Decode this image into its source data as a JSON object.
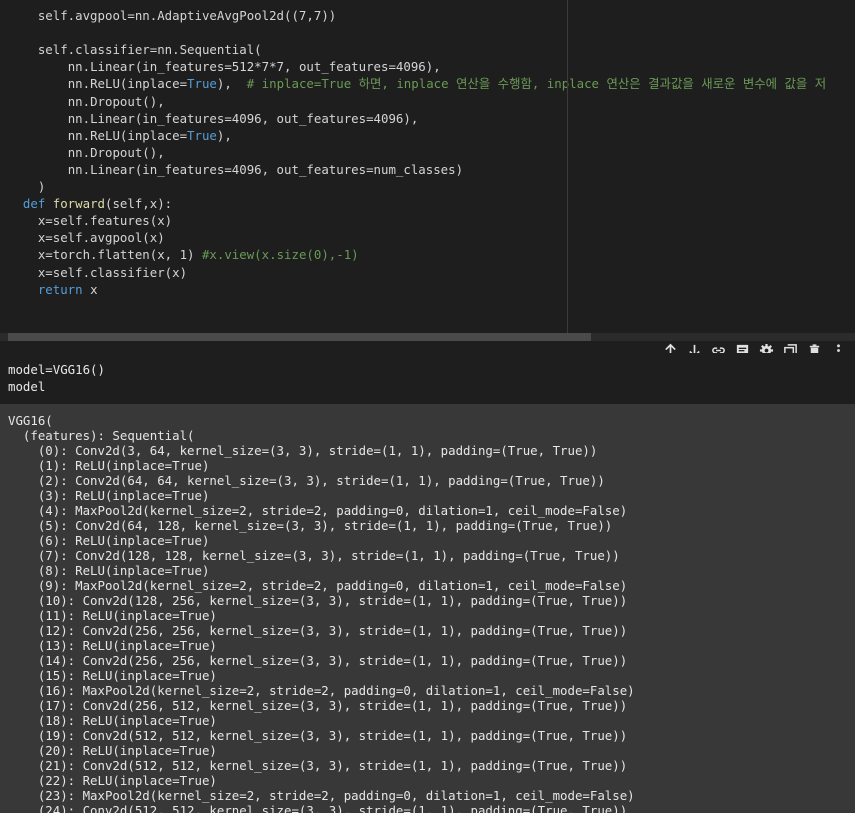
{
  "code_cell": {
    "lines": [
      {
        "indent": "    ",
        "parts": [
          {
            "t": "self.avgpool=nn.AdaptiveAvgPool2d((7,7))",
            "c": ""
          }
        ]
      },
      {
        "indent": "",
        "parts": []
      },
      {
        "indent": "    ",
        "parts": [
          {
            "t": "self.classifier=nn.Sequential(",
            "c": ""
          }
        ]
      },
      {
        "indent": "        ",
        "parts": [
          {
            "t": "nn.Linear(in_features=512*7*7, out_features=4096),",
            "c": ""
          }
        ]
      },
      {
        "indent": "        ",
        "parts": [
          {
            "t": "nn.ReLU(inplace=",
            "c": ""
          },
          {
            "t": "True",
            "c": "kw"
          },
          {
            "t": "),  ",
            "c": ""
          },
          {
            "t": "# inplace=True 하면, inplace 연산을 수행함, inplace 연산은 결과값을 새로운 변수에 값을 저",
            "c": "cm"
          }
        ]
      },
      {
        "indent": "        ",
        "parts": [
          {
            "t": "nn.Dropout(),",
            "c": ""
          }
        ]
      },
      {
        "indent": "        ",
        "parts": [
          {
            "t": "nn.Linear(in_features=4096, out_features=4096),",
            "c": ""
          }
        ]
      },
      {
        "indent": "        ",
        "parts": [
          {
            "t": "nn.ReLU(inplace=",
            "c": ""
          },
          {
            "t": "True",
            "c": "kw"
          },
          {
            "t": "),",
            "c": ""
          }
        ]
      },
      {
        "indent": "        ",
        "parts": [
          {
            "t": "nn.Dropout(),",
            "c": ""
          }
        ]
      },
      {
        "indent": "        ",
        "parts": [
          {
            "t": "nn.Linear(in_features=4096, out_features=num_classes)",
            "c": ""
          }
        ]
      },
      {
        "indent": "    ",
        "parts": [
          {
            "t": ")",
            "c": ""
          }
        ]
      },
      {
        "indent": "  ",
        "parts": [
          {
            "t": "def ",
            "c": "kw"
          },
          {
            "t": "forward",
            "c": "fn"
          },
          {
            "t": "(self,x):",
            "c": ""
          }
        ]
      },
      {
        "indent": "    ",
        "parts": [
          {
            "t": "x=self.features(x)",
            "c": ""
          }
        ]
      },
      {
        "indent": "    ",
        "parts": [
          {
            "t": "x=self.avgpool(x)",
            "c": ""
          }
        ]
      },
      {
        "indent": "    ",
        "parts": [
          {
            "t": "x=torch.flatten(x, 1) ",
            "c": ""
          },
          {
            "t": "#x.view(x.size(0),-1)",
            "c": "cm"
          }
        ]
      },
      {
        "indent": "    ",
        "parts": [
          {
            "t": "x=self.classifier(x)",
            "c": ""
          }
        ]
      },
      {
        "indent": "    ",
        "parts": [
          {
            "t": "return",
            "c": "kw"
          },
          {
            "t": " x",
            "c": ""
          }
        ]
      }
    ]
  },
  "toolbar": {
    "items": [
      {
        "name": "move-up-icon",
        "glyph": "↑"
      },
      {
        "name": "move-down-icon",
        "glyph": "↓"
      },
      {
        "name": "link-icon",
        "glyph": "link"
      },
      {
        "name": "comment-icon",
        "glyph": "comment"
      },
      {
        "name": "settings-icon",
        "glyph": "gear"
      },
      {
        "name": "mirror-cell-icon",
        "glyph": "mirror"
      },
      {
        "name": "delete-icon",
        "glyph": "trash"
      },
      {
        "name": "more-options-icon",
        "glyph": "⋮"
      }
    ]
  },
  "cell2": {
    "lines": [
      "model=VGG16()",
      "model"
    ]
  },
  "output": {
    "lines": [
      "VGG16(",
      "  (features): Sequential(",
      "    (0): Conv2d(3, 64, kernel_size=(3, 3), stride=(1, 1), padding=(True, True))",
      "    (1): ReLU(inplace=True)",
      "    (2): Conv2d(64, 64, kernel_size=(3, 3), stride=(1, 1), padding=(True, True))",
      "    (3): ReLU(inplace=True)",
      "    (4): MaxPool2d(kernel_size=2, stride=2, padding=0, dilation=1, ceil_mode=False)",
      "    (5): Conv2d(64, 128, kernel_size=(3, 3), stride=(1, 1), padding=(True, True))",
      "    (6): ReLU(inplace=True)",
      "    (7): Conv2d(128, 128, kernel_size=(3, 3), stride=(1, 1), padding=(True, True))",
      "    (8): ReLU(inplace=True)",
      "    (9): MaxPool2d(kernel_size=2, stride=2, padding=0, dilation=1, ceil_mode=False)",
      "    (10): Conv2d(128, 256, kernel_size=(3, 3), stride=(1, 1), padding=(True, True))",
      "    (11): ReLU(inplace=True)",
      "    (12): Conv2d(256, 256, kernel_size=(3, 3), stride=(1, 1), padding=(True, True))",
      "    (13): ReLU(inplace=True)",
      "    (14): Conv2d(256, 256, kernel_size=(3, 3), stride=(1, 1), padding=(True, True))",
      "    (15): ReLU(inplace=True)",
      "    (16): MaxPool2d(kernel_size=2, stride=2, padding=0, dilation=1, ceil_mode=False)",
      "    (17): Conv2d(256, 512, kernel_size=(3, 3), stride=(1, 1), padding=(True, True))",
      "    (18): ReLU(inplace=True)",
      "    (19): Conv2d(512, 512, kernel_size=(3, 3), stride=(1, 1), padding=(True, True))",
      "    (20): ReLU(inplace=True)",
      "    (21): Conv2d(512, 512, kernel_size=(3, 3), stride=(1, 1), padding=(True, True))",
      "    (22): ReLU(inplace=True)",
      "    (23): MaxPool2d(kernel_size=2, stride=2, padding=0, dilation=1, ceil_mode=False)",
      "    (24): Conv2d(512, 512, kernel_size=(3, 3), stride=(1, 1), padding=(True, True))"
    ]
  },
  "colors": {
    "editor_bg": "#1e1e1e",
    "output_bg": "#383838",
    "keyword": "#569cd6",
    "function": "#dcdcaa",
    "comment": "#6a9955",
    "text": "#d4d4d4"
  }
}
